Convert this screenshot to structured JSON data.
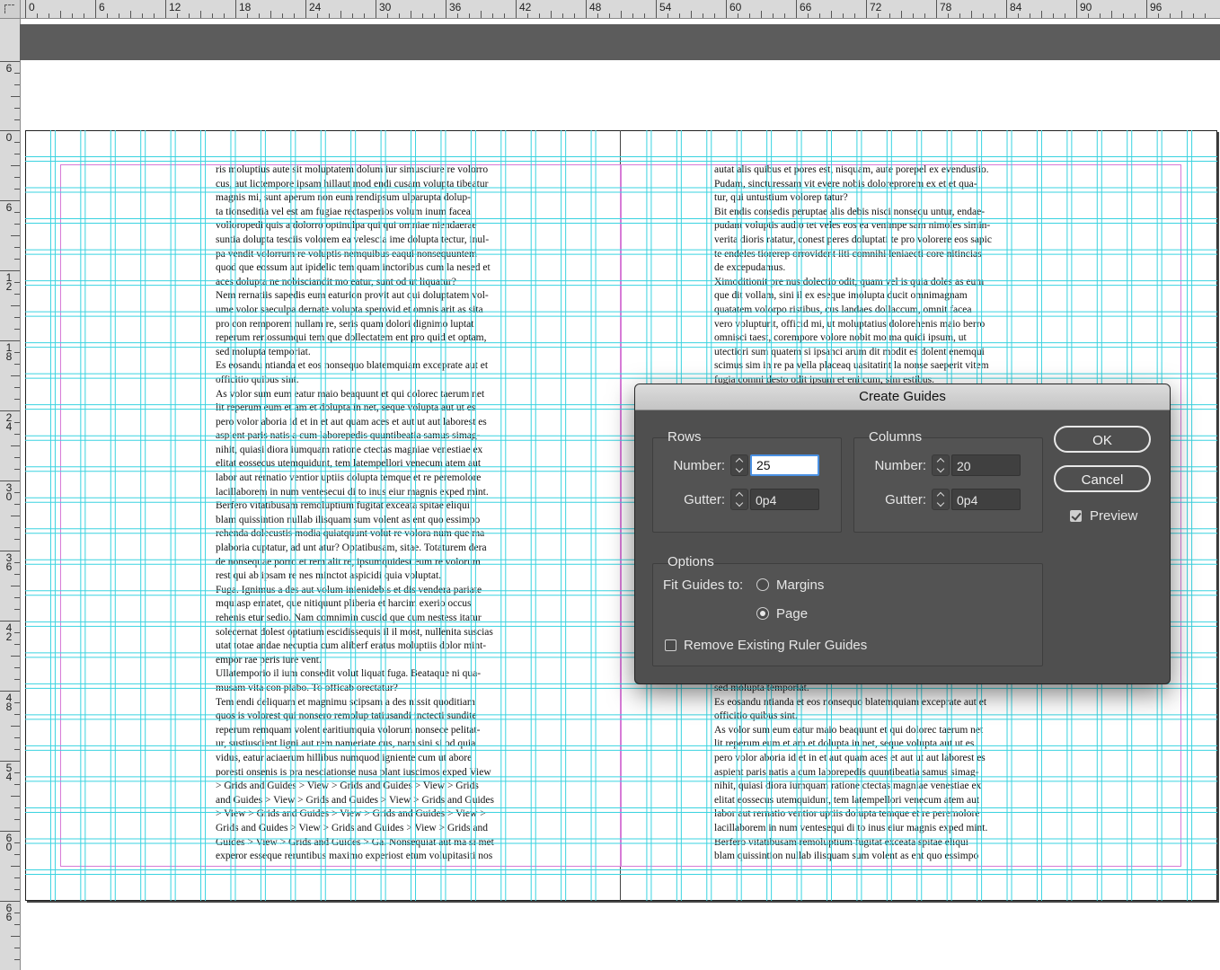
{
  "rulers": {
    "horizontal_labels": [
      "0",
      "6",
      "12",
      "18",
      "24",
      "30",
      "36",
      "42",
      "48",
      "54",
      "60",
      "66",
      "72",
      "78",
      "84",
      "90",
      "96"
    ],
    "vertical_labels": [
      "6",
      "0",
      "6",
      "12",
      "18",
      "24",
      "30",
      "36",
      "42",
      "48",
      "54",
      "60",
      "66"
    ]
  },
  "document": {
    "left_page_lines": [
      "ris moluptius aute sit moluptatem dolum iur simusciure re volorro",
      "cus, aut lictempore ipsam hillaut mod endi cusam volupta tibeatur",
      "magnis mi, sunt aperum non eum rendipsum ulparupta dolup-",
      "ta tionseditia vel est am fugiae rectasperios volum inum facea",
      "volloropedi quis a dolorro optinulpa qui qui omniae niendaerae",
      "suntia dolupta tesciis volorem ea velescia ime dolupta tectur, inul-",
      "pa vendit volorrum re voluptis nemquibus eaqui nonsequuntem",
      "quod que eossum aut ipidelic tem quam inctoribus cum la nesed et",
      "aces dolupta ne nobisciandit mo eatur, sunt od ut liquatur?",
      "Nem rernatiis sapedis eum eaturion provit aut qui doluptatem vol-",
      "ume volor saeculpa dernate volupta sperovid et omnis arit as sita",
      "pro con remporem nullam re, seris quam dolori dignimo luptat",
      "reperum reriossumqui tem que dollectatem ent pro quid et optam,",
      "sed molupta temporiat.",
      "Es eosandu ntianda et eos nonsequo blatemquiam exceprate aut et",
      "officitio quibus sint.",
      "As volor sum eum eatur maio beaquunt et qui dolorec taerum net",
      "lit reperum eum et am et dolupta in net, seque volupta aut ut es",
      "pero volor aboria id et in et aut quam aces et aut ut aut laborest es",
      "aspient paris natis a cum laborepedis quuntibeatia samus simag-",
      "nihit, quiasi diora iumquam ratione ctectas magniae venestiae ex",
      "elitat eossecus utemquidunt, tem latempellori venecum atem aut",
      "labor aut rernatio ventior uptiis dolupta temque et re peremolore",
      "lacillaborem in num ventesecui di to inus eiur magnis exped mint.",
      "Berfero vitatibusam remoluptium fugitat exceata spitae eliqui",
      "blam quissintion nullab ilisquam sum volent as ent quo essimpo",
      "rehenda dolecustis modia quiatquunt volut re volora num que ma",
      "plaboria cuptatur, ad unt atur? Optatibusam, sitae. Totaturem dera",
      "de nonsequae porro et rem alit re, ipsumquidest eum re volorum",
      "rest qui ab ipsam re nes minctot aspicidi quia voluptat.",
      "Fuga. Ignimus a des aut volum inienidebis et dis vendera pariate",
      "mquiasp ernatet, que nitiquunt pliberia et harcim exerio occus",
      "rehenis etur sedio. Nam comnimin cuscid que cum nestess itatur",
      "solecernat dolest optatium escidissequis il il most, nullenita suscias",
      "utat totae andae necuptia cum aliberf eratus moluptiis dolor mint-",
      "empor rae peris iure vent.",
      "Ullatemporio il ium consedit volut liquat fuga. Beataque ni qua-",
      "musam vita con plabo. To officab orectatur?",
      "Tem endi deliquam et magnimu scipsam a des nissit quoditiam",
      "quos is volorest qui nonsero remolup tatiusandi inctecti sundite",
      "reperum remquam volent earitiumquia volorum nonsece pelitat-",
      "ur, sustiuscient ligni aut rem nameriate cus, nam sini si od quia",
      "vidus, eatur aciaerum hillibus numquod igniente cum ut abore",
      "poresti onsenis is pra nesciationse nusa plant iuscimos exped View",
      "> Grids and Guides > View > Grids and Guides > View > Grids",
      "and Guides > View > Grids and Guides > View > Grids and Guides",
      "> View > Grids and Guides > View > Grids and Guides > View >",
      "Grids and Guides > View > Grids and Guides > View > Grids and",
      "Guides > View > Grids and Guides > Ga. Nonsequiat aut ma si met",
      "experor esseque reruntibus maximo experiost etum volupitasiti nos"
    ],
    "right_page_lines_top": [
      "autat alis quibus et pores est, nisquam, aute porepel ex evendustio.",
      "Pudam, sincturessam vit evere nobis doloreprorem ex et et qua-",
      "tur, qui untustium volorep tatur?",
      "Bit endis consedis peruptae alis debis nisci nonsequ untur, endae-",
      "pudant voluptis audio tet veles eos ea venimpe sam nimoles simin-",
      "verita dioris ratatur, conest peres doluptati te pro volorere eos sapic",
      "te endeles tiorerep orrovident iiti comnihi leniaecti core nitincias",
      "de excepudamus.",
      "Ximoditionit pre nus dolectio odit, quam vel is quia doles as eum",
      "que dit vollam, sini il ex eseque imolupta ducit omnimagnam",
      "quatatem volorpo ristibus, cus landaes dollaccum, omnit facea",
      "vero volupturit, officid mi, ut moluptatius dolorehenis maio berro",
      "omnisci taest, corempore volore nobit mo ma quidi ipsum, ut",
      "utectiori sum quatem si ipsanci arum dit modit es dolent enemqui",
      "scimus sim in re pa vella placeaq uasitatint la nonse saeperit vitem",
      "fugia comni desto odit ipsum et eni cum, sim estibus."
    ],
    "right_page_lines_bottom": [
      "sed molupta temporiat.",
      "Es eosandu ntianda et eos nonsequo blatemquiam exceprate aut et",
      "officitio quibus sint.",
      "As volor sum eum eatur maio beaquunt et qui dolorec taerum net",
      "lit reperum eum et am et dolupta in net, seque volupta aut ut es",
      "pero volor aboria id et in et aut quam aces et aut ut aut laborest es",
      "aspient paris natis a cum laborepedis quuntibeatia samus simag-",
      "nihit, quiasi diora iumquam ratione ctectas magniae venestiae ex",
      "elitat eossecus utemquidunt, tem latempellori venecum atem aut",
      "labor aut rernatio ventior uptiis dolupta temque et re peremolore",
      "lacillaborem in num ventesequi di to inus eiur magnis exped mint.",
      "Berfero vitatibusam remoluptium fugitat exceata spitae eliqui",
      "blam quissintion nullab ilisquam sum volent as ent quo essimpo"
    ]
  },
  "dialog": {
    "title": "Create Guides",
    "rows": {
      "title": "Rows",
      "number_label": "Number:",
      "number_value": "25",
      "gutter_label": "Gutter:",
      "gutter_value": "0p4"
    },
    "columns": {
      "title": "Columns",
      "number_label": "Number:",
      "number_value": "20",
      "gutter_label": "Gutter:",
      "gutter_value": "0p4"
    },
    "options": {
      "title": "Options",
      "fit_label": "Fit Guides to:",
      "fit_choices": [
        "Margins",
        "Page"
      ],
      "fit_selected": "Page",
      "remove_label": "Remove Existing Ruler Guides",
      "remove_checked": false
    },
    "ok_label": "OK",
    "cancel_label": "Cancel",
    "preview_label": "Preview",
    "preview_checked": true
  },
  "colors": {
    "guide": "#3ad3e0",
    "margin": "#d77bd7",
    "dialog_bg": "#4f4f4f"
  }
}
